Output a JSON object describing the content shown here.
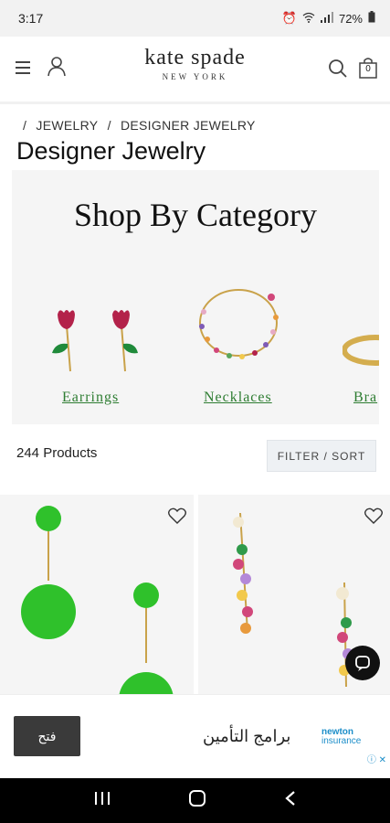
{
  "status_bar": {
    "time": "3:17",
    "battery": "72%"
  },
  "header": {
    "logo_main": "kate spade",
    "logo_sub": "NEW YORK",
    "bag_count": "0"
  },
  "breadcrumb": [
    "/",
    "JEWELRY",
    "/",
    "DESIGNER JEWELRY"
  ],
  "page_title": "Designer Jewelry",
  "category": {
    "heading": "Shop By Category",
    "items": [
      {
        "label": "Earrings"
      },
      {
        "label": "Necklaces"
      },
      {
        "label": "Bra"
      }
    ]
  },
  "results": {
    "count": "244 Products",
    "filter_label": "FILTER / SORT"
  },
  "ad": {
    "button_label": "فتح",
    "text": "برامج التأمين",
    "brand_line1": "newton",
    "brand_line2": "insurance"
  }
}
